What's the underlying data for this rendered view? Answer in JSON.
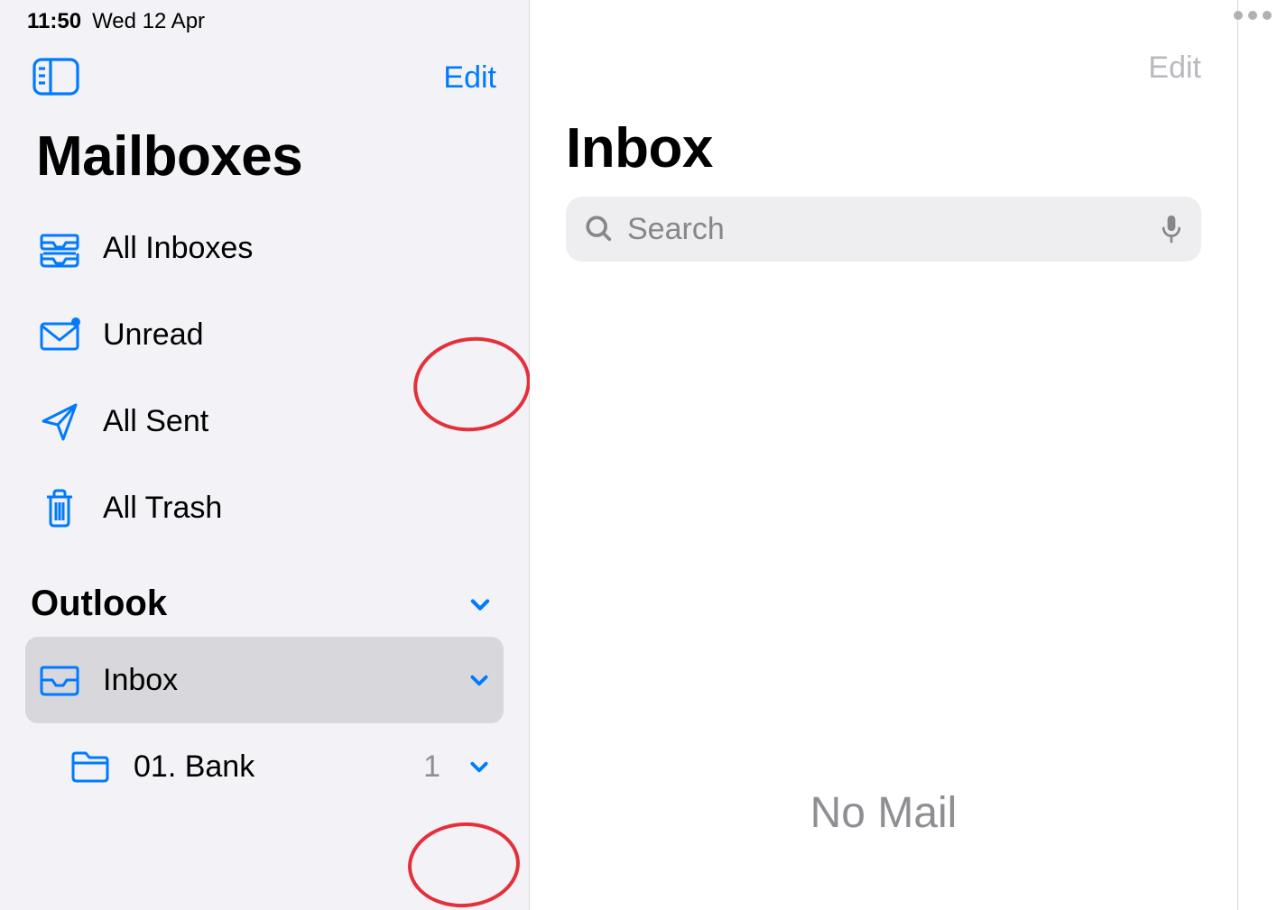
{
  "statusbar": {
    "time": "11:50",
    "date": "Wed 12 Apr"
  },
  "sidebar": {
    "edit_label": "Edit",
    "title": "Mailboxes",
    "items": [
      {
        "icon": "inbox-stack",
        "label": "All Inboxes"
      },
      {
        "icon": "envelope-unread",
        "label": "Unread"
      },
      {
        "icon": "paperplane",
        "label": "All Sent"
      },
      {
        "icon": "trash",
        "label": "All Trash"
      }
    ],
    "account": {
      "name": "Outlook",
      "folders": [
        {
          "icon": "inbox",
          "label": "Inbox",
          "selected": true,
          "expandable": true
        },
        {
          "icon": "folder",
          "label": "01. Bank",
          "count": "1",
          "expandable": true,
          "sub": true
        }
      ]
    }
  },
  "main": {
    "edit_label": "Edit",
    "title": "Inbox",
    "search_placeholder": "Search",
    "empty_label": "No Mail"
  }
}
